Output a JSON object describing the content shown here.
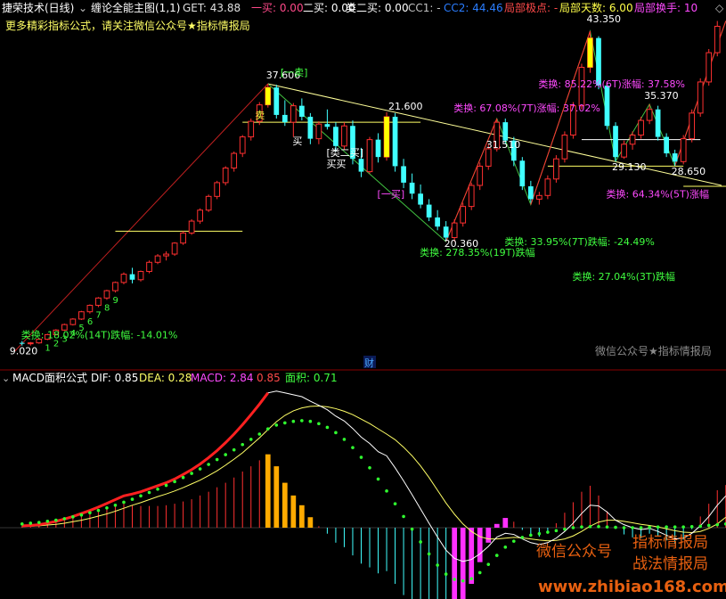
{
  "header": {
    "stock_name": "捷荣技术(日线)",
    "indicator": "缠论全能主图(1,1)",
    "items": [
      {
        "label": "GET: 43.88",
        "color": "#e0e0e0"
      },
      {
        "label": "一买: 0.00",
        "color": "#ff4a8a"
      },
      {
        "label": "二买: 0.00",
        "color": "#ffffff"
      },
      {
        "label": "类二买: 0.00",
        "color": "#ffffff"
      },
      {
        "label": "CC1: -",
        "color": "#c0c0c0"
      },
      {
        "label": "CC2: 44.46",
        "color": "#2a7dff"
      },
      {
        "label": "局部极点: -",
        "color": "#ff4a4a"
      },
      {
        "label": "局部天数: 6.00",
        "color": "#ffff4a"
      },
      {
        "label": "局部换手: 10",
        "color": "#ff4aff"
      }
    ]
  },
  "banner_text": "更多精彩指标公式，请关注微信公众号★指标情报局",
  "watermark_main": "微信公众号★指标情报局",
  "watermark_bottom": {
    "wechat": "微信公众号",
    "brand1": "指标情报局",
    "brand2": "战法情报局",
    "url": "www.zhibiao168.com"
  },
  "fin_marker": "财",
  "macd_header": {
    "title": "MACD面积公式",
    "dif": "DIF: 0.85",
    "dea": "DEA: 0.28",
    "macd": "MACD: 2.84",
    "extra": "0.85",
    "area": "面积: 0.71"
  },
  "chart_data": {
    "type": "candlestick",
    "price_labels": [
      {
        "text": "9.020",
        "color": "#ffffff"
      },
      {
        "text": "37.606",
        "color": "#ffffff"
      },
      {
        "text": "21.600",
        "color": "#ffffff"
      },
      {
        "text": "43.350",
        "color": "#ffffff"
      },
      {
        "text": "20.360",
        "color": "#ffffff"
      },
      {
        "text": "31.510",
        "color": "#ffffff"
      },
      {
        "text": "29.130",
        "color": "#ffffff"
      },
      {
        "text": "35.370",
        "color": "#ffffff"
      },
      {
        "text": "28.650",
        "color": "#ffffff"
      }
    ],
    "annotations": [
      {
        "text": "[一卖]",
        "color": "#40ff40"
      },
      {
        "text": "卖",
        "color": "#ffff40"
      },
      {
        "text": "[类二买]",
        "color": "#ffffff"
      },
      {
        "text": "买",
        "color": "#ffffff"
      },
      {
        "text": "买买",
        "color": "#ffffff"
      },
      {
        "text": "[一买]",
        "color": "#ff4aff"
      },
      {
        "text": "类换: 67.08%(7T)涨幅: 37.02%",
        "color": "#ff4aff"
      },
      {
        "text": "类换: 85.22%(6T)涨幅: 37.58%",
        "color": "#ff4aff"
      },
      {
        "text": "类换: 278.35%(19T)跌幅",
        "color": "#40ff40"
      },
      {
        "text": "类换: 33.95%(7T)跌幅: -24.49%",
        "color": "#40ff40"
      },
      {
        "text": "类换: 27.04%(3T)跌幅",
        "color": "#40ff40"
      },
      {
        "text": "类换: 64.34%(5T)涨幅",
        "color": "#ff4aff"
      },
      {
        "text": "类换: 18.02%(14T)跌幅: -14.01%",
        "color": "#40ff40"
      }
    ],
    "candles": [
      [
        9.3,
        9.5,
        9.0,
        9.2
      ],
      [
        9.2,
        9.4,
        9.0,
        9.3
      ],
      [
        9.3,
        9.8,
        9.2,
        9.7
      ],
      [
        9.7,
        10.3,
        9.6,
        10.2
      ],
      [
        10.2,
        10.8,
        10.1,
        10.7
      ],
      [
        10.7,
        11.4,
        10.6,
        11.3
      ],
      [
        11.3,
        12.0,
        11.2,
        11.9
      ],
      [
        11.9,
        12.8,
        11.8,
        12.7
      ],
      [
        12.7,
        13.5,
        12.5,
        13.4
      ],
      [
        13.4,
        14.3,
        13.2,
        14.2
      ],
      [
        14.2,
        15.1,
        14.0,
        15.0
      ],
      [
        15.0,
        16.0,
        14.8,
        15.9
      ],
      [
        15.9,
        17.0,
        15.7,
        16.8
      ],
      [
        16.8,
        17.5,
        15.8,
        16.2
      ],
      [
        16.2,
        17.2,
        16.0,
        17.1
      ],
      [
        17.1,
        18.3,
        16.9,
        18.1
      ],
      [
        18.1,
        19.0,
        17.9,
        18.8
      ],
      [
        18.8,
        19.3,
        18.3,
        19.0
      ],
      [
        19.0,
        20.3,
        18.8,
        20.2
      ],
      [
        20.2,
        21.5,
        20.0,
        21.3
      ],
      [
        21.3,
        22.8,
        21.1,
        22.6
      ],
      [
        22.6,
        24.0,
        22.3,
        23.8
      ],
      [
        23.8,
        25.5,
        23.6,
        25.3
      ],
      [
        25.3,
        27.0,
        25.0,
        26.8
      ],
      [
        26.8,
        28.6,
        26.5,
        28.4
      ],
      [
        28.4,
        30.2,
        28.0,
        30.0
      ],
      [
        30.0,
        32.0,
        29.6,
        31.8
      ],
      [
        31.8,
        33.8,
        31.4,
        33.5
      ],
      [
        33.5,
        35.6,
        33.1,
        35.3
      ],
      [
        35.3,
        37.6,
        35.0,
        37.2
      ],
      [
        37.2,
        37.5,
        33.8,
        34.2
      ],
      [
        34.2,
        35.8,
        33.0,
        33.4
      ],
      [
        33.4,
        35.5,
        31.8,
        35.2
      ],
      [
        35.2,
        36.0,
        33.6,
        34.0
      ],
      [
        34.0,
        34.4,
        31.0,
        31.6
      ],
      [
        31.6,
        33.5,
        31.0,
        33.2
      ],
      [
        33.2,
        34.8,
        32.6,
        32.9
      ],
      [
        32.9,
        33.4,
        30.2,
        30.8
      ],
      [
        30.8,
        33.4,
        30.4,
        33.0
      ],
      [
        33.0,
        33.6,
        28.8,
        29.4
      ],
      [
        29.4,
        30.6,
        27.4,
        28.0
      ],
      [
        28.0,
        31.8,
        27.8,
        31.5
      ],
      [
        31.5,
        32.2,
        29.0,
        29.6
      ],
      [
        29.6,
        34.5,
        29.2,
        34.0
      ],
      [
        34.0,
        34.4,
        28.0,
        28.6
      ],
      [
        28.6,
        29.4,
        26.2,
        26.8
      ],
      [
        26.8,
        27.8,
        25.0,
        25.6
      ],
      [
        25.6,
        26.6,
        24.0,
        24.4
      ],
      [
        24.4,
        25.0,
        22.6,
        23.0
      ],
      [
        23.0,
        23.8,
        21.6,
        22.0
      ],
      [
        22.0,
        22.6,
        20.4,
        20.8
      ],
      [
        20.8,
        22.8,
        20.36,
        22.4
      ],
      [
        22.4,
        24.6,
        22.0,
        24.2
      ],
      [
        24.2,
        26.8,
        23.8,
        26.5
      ],
      [
        26.5,
        29.0,
        26.0,
        28.6
      ],
      [
        28.6,
        31.0,
        28.2,
        30.5
      ],
      [
        30.5,
        33.8,
        30.2,
        33.4
      ],
      [
        33.4,
        33.8,
        31.0,
        31.4
      ],
      [
        31.4,
        31.8,
        28.6,
        29.2
      ],
      [
        29.2,
        29.6,
        26.0,
        26.4
      ],
      [
        26.4,
        27.0,
        24.6,
        25.0
      ],
      [
        25.0,
        25.8,
        24.4,
        25.4
      ],
      [
        25.4,
        27.6,
        25.0,
        27.2
      ],
      [
        27.2,
        29.8,
        26.8,
        29.4
      ],
      [
        29.4,
        32.4,
        29.0,
        32.0
      ],
      [
        32.0,
        35.6,
        31.6,
        35.2
      ],
      [
        35.2,
        39.8,
        34.8,
        39.4
      ],
      [
        39.4,
        43.35,
        38.8,
        42.6
      ],
      [
        42.6,
        42.8,
        37.0,
        37.4
      ],
      [
        37.4,
        37.8,
        32.6,
        33.0
      ],
      [
        33.0,
        33.4,
        29.13,
        29.6
      ],
      [
        29.6,
        31.4,
        29.4,
        31.0
      ],
      [
        31.0,
        32.4,
        30.4,
        32.0
      ],
      [
        32.0,
        34.0,
        31.6,
        33.6
      ],
      [
        33.6,
        35.37,
        33.2,
        34.8
      ],
      [
        34.8,
        35.2,
        31.4,
        31.8
      ],
      [
        31.8,
        32.2,
        29.6,
        30.0
      ],
      [
        30.0,
        30.4,
        28.65,
        29.1
      ],
      [
        29.1,
        32.0,
        28.8,
        31.6
      ],
      [
        31.6,
        34.8,
        31.2,
        34.4
      ],
      [
        34.4,
        38.2,
        34.0,
        37.8
      ],
      [
        37.8,
        41.4,
        37.4,
        41.0
      ],
      [
        41.0,
        44.46,
        40.6,
        43.88
      ]
    ],
    "dif": [
      0.05,
      0.06,
      0.08,
      0.12,
      0.17,
      0.23,
      0.3,
      0.38,
      0.46,
      0.55,
      0.65,
      0.75,
      0.85,
      0.9,
      0.96,
      1.04,
      1.12,
      1.2,
      1.3,
      1.42,
      1.55,
      1.7,
      1.87,
      2.06,
      2.27,
      2.5,
      2.75,
      3.02,
      3.3,
      3.6,
      3.65,
      3.6,
      3.55,
      3.5,
      3.38,
      3.27,
      3.15,
      2.98,
      2.85,
      2.65,
      2.42,
      2.25,
      2.03,
      1.92,
      1.6,
      1.25,
      0.88,
      0.5,
      0.12,
      -0.25,
      -0.6,
      -0.82,
      -0.9,
      -0.85,
      -0.7,
      -0.5,
      -0.25,
      -0.15,
      -0.18,
      -0.3,
      -0.4,
      -0.45,
      -0.4,
      -0.28,
      -0.1,
      0.12,
      0.38,
      0.6,
      0.58,
      0.42,
      0.2,
      0.08,
      0.0,
      -0.05,
      -0.02,
      -0.1,
      -0.2,
      -0.3,
      -0.28,
      -0.15,
      0.05,
      0.3,
      0.6,
      0.85
    ],
    "dea": [
      0.03,
      0.04,
      0.05,
      0.07,
      0.09,
      0.12,
      0.16,
      0.2,
      0.25,
      0.31,
      0.37,
      0.44,
      0.52,
      0.6,
      0.67,
      0.75,
      0.83,
      0.9,
      0.98,
      1.07,
      1.17,
      1.27,
      1.39,
      1.52,
      1.67,
      1.83,
      2.0,
      2.2,
      2.4,
      2.62,
      2.83,
      3.0,
      3.12,
      3.2,
      3.24,
      3.25,
      3.23,
      3.18,
      3.11,
      3.02,
      2.9,
      2.78,
      2.64,
      2.5,
      2.35,
      2.15,
      1.92,
      1.65,
      1.34,
      1.0,
      0.66,
      0.36,
      0.1,
      -0.1,
      -0.24,
      -0.3,
      -0.3,
      -0.28,
      -0.26,
      -0.27,
      -0.3,
      -0.33,
      -0.35,
      -0.34,
      -0.3,
      -0.22,
      -0.1,
      0.04,
      0.15,
      0.2,
      0.2,
      0.17,
      0.13,
      0.09,
      0.06,
      0.02,
      -0.03,
      -0.08,
      -0.12,
      -0.13,
      -0.1,
      -0.02,
      0.1,
      0.28
    ],
    "dots": [
      0.1,
      0.12,
      0.14,
      0.17,
      0.2,
      0.24,
      0.29,
      0.34,
      0.4,
      0.46,
      0.53,
      0.6,
      0.68,
      0.76,
      0.85,
      0.94,
      1.03,
      1.13,
      1.23,
      1.34,
      1.45,
      1.57,
      1.69,
      1.82,
      1.95,
      2.08,
      2.22,
      2.36,
      2.5,
      2.64,
      2.74,
      2.8,
      2.84,
      2.86,
      2.84,
      2.78,
      2.68,
      2.54,
      2.36,
      2.14,
      1.88,
      1.6,
      1.3,
      0.98,
      0.64,
      0.3,
      -0.04,
      -0.38,
      -0.7,
      -1.0,
      -1.24,
      -1.38,
      -1.42,
      -1.36,
      -1.2,
      -0.98,
      -0.74,
      -0.52,
      -0.36,
      -0.26,
      -0.2,
      -0.16,
      -0.12,
      -0.08,
      -0.04,
      0.0,
      0.02,
      0.03,
      0.03,
      0.02,
      0.01,
      0.0,
      0.0,
      0.0,
      0.01,
      0.02,
      0.02,
      0.02,
      0.02,
      0.03,
      0.04,
      0.06,
      0.08,
      0.1
    ]
  }
}
